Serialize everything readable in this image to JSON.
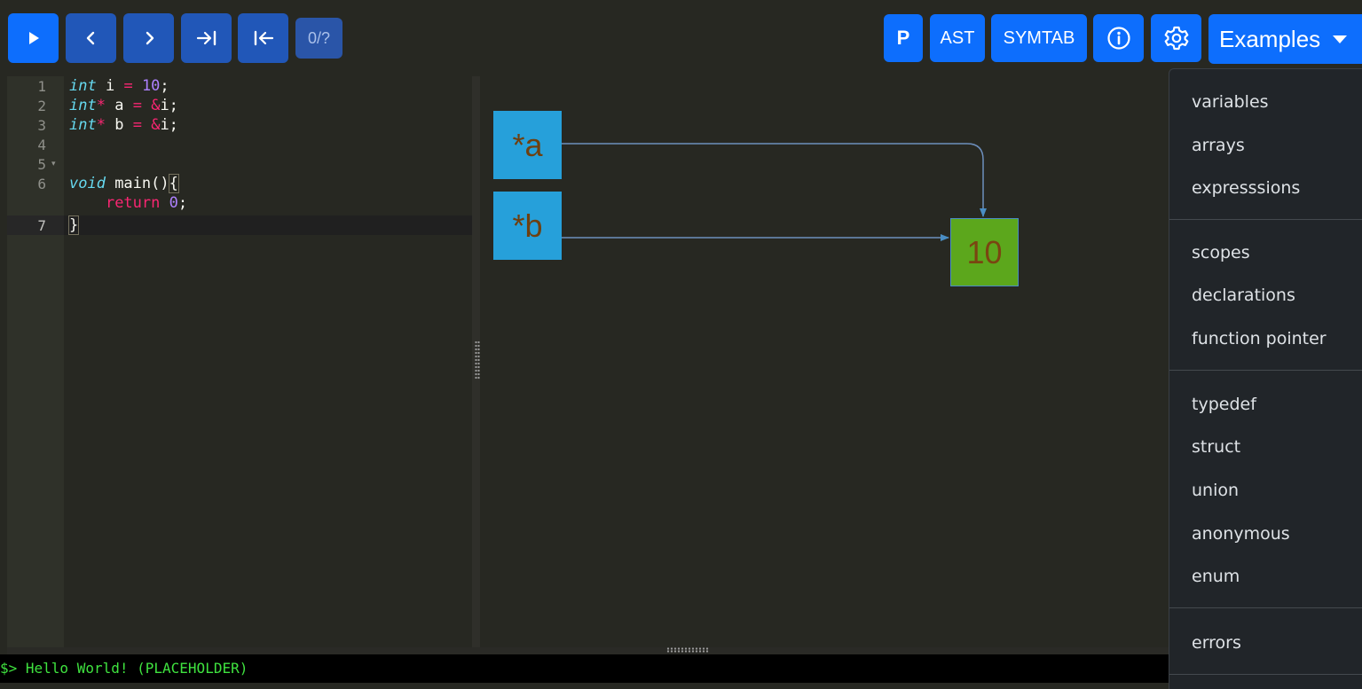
{
  "toolbar": {
    "step_counter": "0/?",
    "buttons": {
      "run": "play-icon",
      "step_back": "chevron-left-icon",
      "step_forward": "chevron-right-icon",
      "step_to_end": "arrow-to-end-icon",
      "step_to_start": "arrow-to-start-icon"
    },
    "right": {
      "p_label": "P",
      "ast_label": "AST",
      "symtab_label": "SYMTAB",
      "info_icon": "info-icon",
      "settings_icon": "gear-icon",
      "examples_label": "Examples"
    }
  },
  "editor": {
    "line_numbers": [
      "1",
      "2",
      "3",
      "4",
      "5",
      "6",
      "7"
    ],
    "lines": [
      "int i = 10;",
      "int* a = &i;",
      "int* b = &i;",
      "",
      "void main(){",
      "    return 0;",
      "}"
    ]
  },
  "visualization": {
    "pointers": [
      "*a",
      "*b"
    ],
    "target_value": "10"
  },
  "examples_menu": {
    "groups": [
      [
        "variables",
        "arrays",
        "expresssions"
      ],
      [
        "scopes",
        "declarations",
        "function pointer"
      ],
      [
        "typedef",
        "struct",
        "union",
        "anonymous",
        "enum"
      ],
      [
        "errors"
      ]
    ]
  },
  "terminal": {
    "output": "$> Hello World! (PLACEHOLDER)"
  },
  "colors": {
    "primary": "#0d6efd",
    "background": "#272822",
    "pointer_box": "#26a0da",
    "value_box": "#5ca71c",
    "terminal_text": "#3fe23f"
  }
}
